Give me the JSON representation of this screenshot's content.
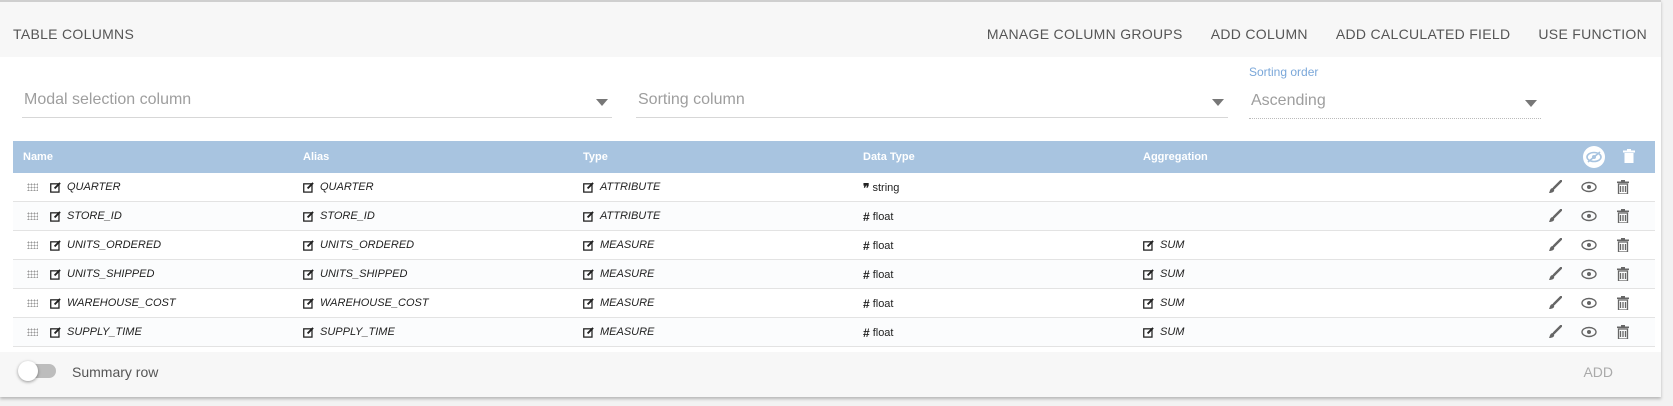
{
  "toolbar": {
    "title": "TABLE COLUMNS",
    "actions": [
      "MANAGE COLUMN GROUPS",
      "ADD COLUMN",
      "ADD CALCULATED FIELD",
      "USE FUNCTION"
    ]
  },
  "selects": {
    "modal": {
      "placeholder": "Modal selection column"
    },
    "sorting": {
      "placeholder": "Sorting column"
    },
    "order": {
      "label": "Sorting order",
      "value": "Ascending"
    }
  },
  "table": {
    "headers": [
      "Name",
      "Alias",
      "Type",
      "Data Type",
      "Aggregation"
    ],
    "rows": [
      {
        "name": "QUARTER",
        "alias": "QUARTER",
        "type": "ATTRIBUTE",
        "dtype_icon": "quote-icon",
        "dtype": "string",
        "aggregation": ""
      },
      {
        "name": "STORE_ID",
        "alias": "STORE_ID",
        "type": "ATTRIBUTE",
        "dtype_icon": "hash-icon",
        "dtype": "float",
        "aggregation": ""
      },
      {
        "name": "UNITS_ORDERED",
        "alias": "UNITS_ORDERED",
        "type": "MEASURE",
        "dtype_icon": "hash-icon",
        "dtype": "float",
        "aggregation": "SUM"
      },
      {
        "name": "UNITS_SHIPPED",
        "alias": "UNITS_SHIPPED",
        "type": "MEASURE",
        "dtype_icon": "hash-icon",
        "dtype": "float",
        "aggregation": "SUM"
      },
      {
        "name": "WAREHOUSE_COST",
        "alias": "WAREHOUSE_COST",
        "type": "MEASURE",
        "dtype_icon": "hash-icon",
        "dtype": "float",
        "aggregation": "SUM"
      },
      {
        "name": "SUPPLY_TIME",
        "alias": "SUPPLY_TIME",
        "type": "MEASURE",
        "dtype_icon": "hash-icon",
        "dtype": "float",
        "aggregation": "SUM"
      }
    ]
  },
  "footer": {
    "summary_label": "Summary row",
    "summary_enabled": false,
    "add_label": "ADD"
  },
  "colors": {
    "header_bg": "#a8c4e0",
    "label_accent": "#7aa7d9"
  }
}
